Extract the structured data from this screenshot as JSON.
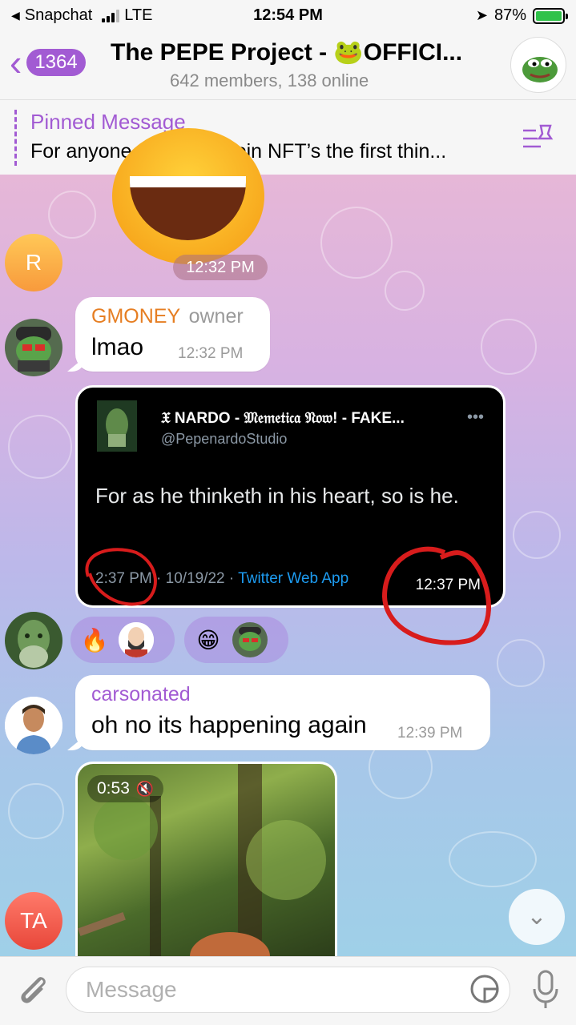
{
  "status_bar": {
    "back_app": "Snapchat",
    "network": "LTE",
    "time": "12:54 PM",
    "battery": "87%"
  },
  "header": {
    "unread_count": "1364",
    "title": "The PEPE Project - 🐸OFFICI...",
    "subtitle": "642 members, 138 online"
  },
  "pinned": {
    "label": "Pinned Message",
    "text": "For anyone new to Bitcoin NFT’s the first thin..."
  },
  "messages": {
    "sticker_time": "12:32 PM",
    "r_avatar_letter": "R",
    "gmoney": {
      "sender": "GMONEY",
      "role": "owner",
      "text": "lmao",
      "time": "12:32 PM"
    },
    "tweet": {
      "name": "𝔛 NARDO - 𝔐𝔢𝔪𝔢𝔱𝔦𝔠𝔞 𝔑𝔬𝔴! - FAKE...",
      "handle": "@PepenardoStudio",
      "text": "For as he thinketh in his heart, so is he.",
      "tweet_time": "2:37 PM",
      "separator": "·",
      "date": "10/19/22",
      "source": "Twitter Web App",
      "msg_time": "12:37 PM"
    },
    "reactions": [
      {
        "emoji": "🔥"
      },
      {
        "emoji": "😁"
      }
    ],
    "carsonated": {
      "sender": "carsonated",
      "text": "oh no its happening again",
      "time": "12:39 PM"
    },
    "video": {
      "duration": "0:53",
      "mute_icon": "🔇"
    },
    "ta_avatar_letters": "TA"
  },
  "composer": {
    "placeholder": "Message"
  },
  "colors": {
    "accent": "#a25bd3",
    "gmoney_name": "#e67e22",
    "carsonated_name": "#a25bd3",
    "annotation_red": "#d81c1c"
  }
}
